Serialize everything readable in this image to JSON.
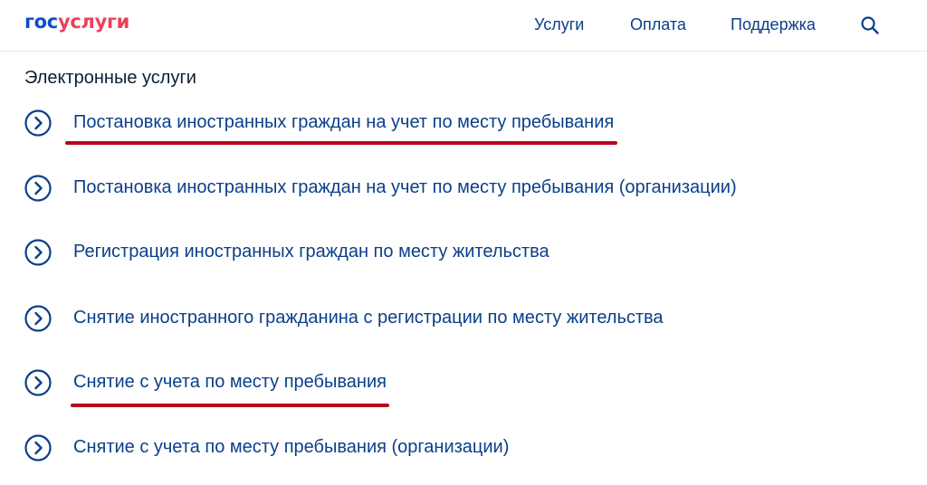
{
  "header": {
    "logo_part1": "гос",
    "logo_part2": "услуги",
    "nav": [
      "Услуги",
      "Оплата",
      "Поддержка"
    ],
    "search_icon": "search-icon"
  },
  "section_title": "Электронные услуги",
  "services": [
    {
      "label": "Постановка иностранных граждан на учет по месту пребывания",
      "highlighted": true
    },
    {
      "label": "Постановка иностранных граждан на учет по месту пребывания (организации)",
      "highlighted": false
    },
    {
      "label": "Регистрация иностранных граждан по месту жительства",
      "highlighted": false
    },
    {
      "label": "Снятие иностранного гражданина с регистрации по месту жительства",
      "highlighted": false
    },
    {
      "label": "Снятие с учета по месту пребывания",
      "highlighted": true
    },
    {
      "label": "Снятие с учета по месту пребывания (организации)",
      "highlighted": false
    }
  ],
  "colors": {
    "link": "#0b3f8a",
    "logo_blue": "#0d4cd3",
    "logo_red": "#ee3f58",
    "highlight_underline": "#b5071e"
  }
}
